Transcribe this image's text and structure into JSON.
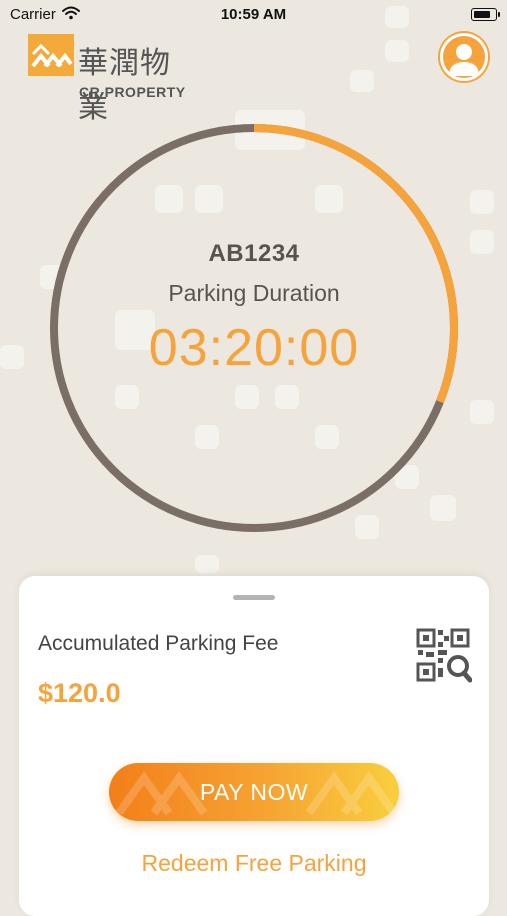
{
  "status_bar": {
    "carrier": "Carrier",
    "time": "10:59 AM"
  },
  "header": {
    "logo_cn": "華潤物業",
    "logo_en": "CR PROPERTY",
    "avatar_icon": "user-icon"
  },
  "parking": {
    "plate": "AB1234",
    "duration_label": "Parking Duration",
    "duration_value": "03:20:00",
    "progress_fraction": 0.31
  },
  "card": {
    "fee_label": "Accumulated Parking Fee",
    "fee_value": "$120.0",
    "qr_icon": "qr-scan-icon",
    "pay_button_label": "PAY NOW",
    "redeem_label": "Redeem Free Parking"
  },
  "colors": {
    "accent": "#f6a33b",
    "ring_track": "#7a6e66",
    "background": "#ece8df"
  }
}
